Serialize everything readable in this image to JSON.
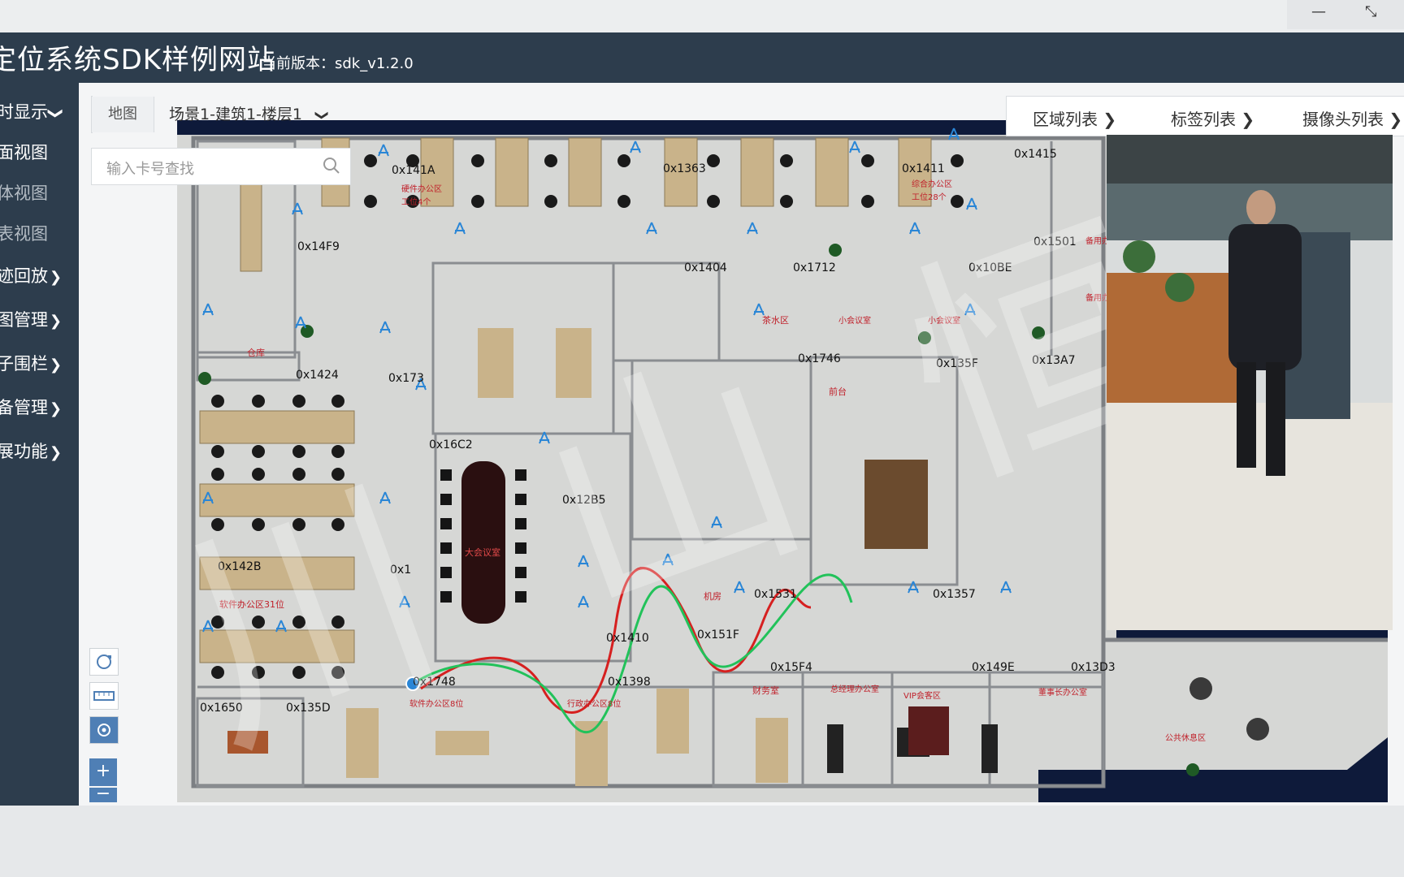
{
  "app": {
    "title": "定位系统SDK样例网站",
    "version_label": "当前版本：sdk_v1.2.0"
  },
  "window_controls": {
    "minimize": "—",
    "restore": "⤡"
  },
  "sidebar": {
    "items": [
      {
        "label": "时显示",
        "chevron": "❯"
      },
      {
        "label": "面视图",
        "chevron": ""
      },
      {
        "label": "体视图",
        "chevron": ""
      },
      {
        "label": "表视图",
        "chevron": ""
      },
      {
        "label": "迹回放",
        "chevron": "❯"
      },
      {
        "label": "图管理",
        "chevron": "❯"
      },
      {
        "label": "子围栏",
        "chevron": "❯"
      },
      {
        "label": "备管理",
        "chevron": "❯"
      },
      {
        "label": "展功能",
        "chevron": "❯"
      }
    ]
  },
  "toolbar": {
    "map_tab": "地图",
    "floor_select": "场景1-建筑1-楼层1"
  },
  "search": {
    "placeholder": "输入卡号查找"
  },
  "right_panel": {
    "links": [
      "区域列表",
      "标签列表",
      "摄像头列表"
    ]
  },
  "map": {
    "tag_ids": [
      "0x141A",
      "0x1363",
      "0x1411",
      "0x1415",
      "0x14F9",
      "0x1501",
      "0x1404",
      "0x1712",
      "0x10BE",
      "0x1424",
      "0x1746",
      "0x135F",
      "0x13A7",
      "0x173",
      "0x16C2",
      "0x12B5",
      "0x1531",
      "0x1357",
      "0x1410",
      "0x151F",
      "0x1748",
      "0x1398",
      "0x15F4",
      "0x149E",
      "0x13D3",
      "0x1650",
      "0x135D",
      "0x142B",
      "0x1"
    ],
    "room_labels": [
      "硬件办公区",
      "工位4个",
      "综合办公区",
      "工位28个",
      "仓库",
      "茶水区",
      "小会议室",
      "小会议室",
      "前台",
      "大会议室",
      "机房",
      "软件办公区31位",
      "软件办公区8位",
      "行政办公区8位",
      "财务室",
      "总经理办公室",
      "VIP会客区",
      "董事长办公室",
      "公共休息区",
      "备用办",
      "备用办"
    ]
  },
  "watermark": "川 山 恒 富",
  "map_tools": {
    "zoom_in": "+",
    "zoom_out": "−"
  },
  "colors": {
    "header_bg": "#2d3d4d",
    "sidebar_bg": "#2d3d4d",
    "map_bg": "#0e1a3a",
    "floor": "#d9dad8",
    "anchor_blue": "#2a86d6",
    "track_red": "#d62020",
    "track_green": "#22c25a"
  }
}
